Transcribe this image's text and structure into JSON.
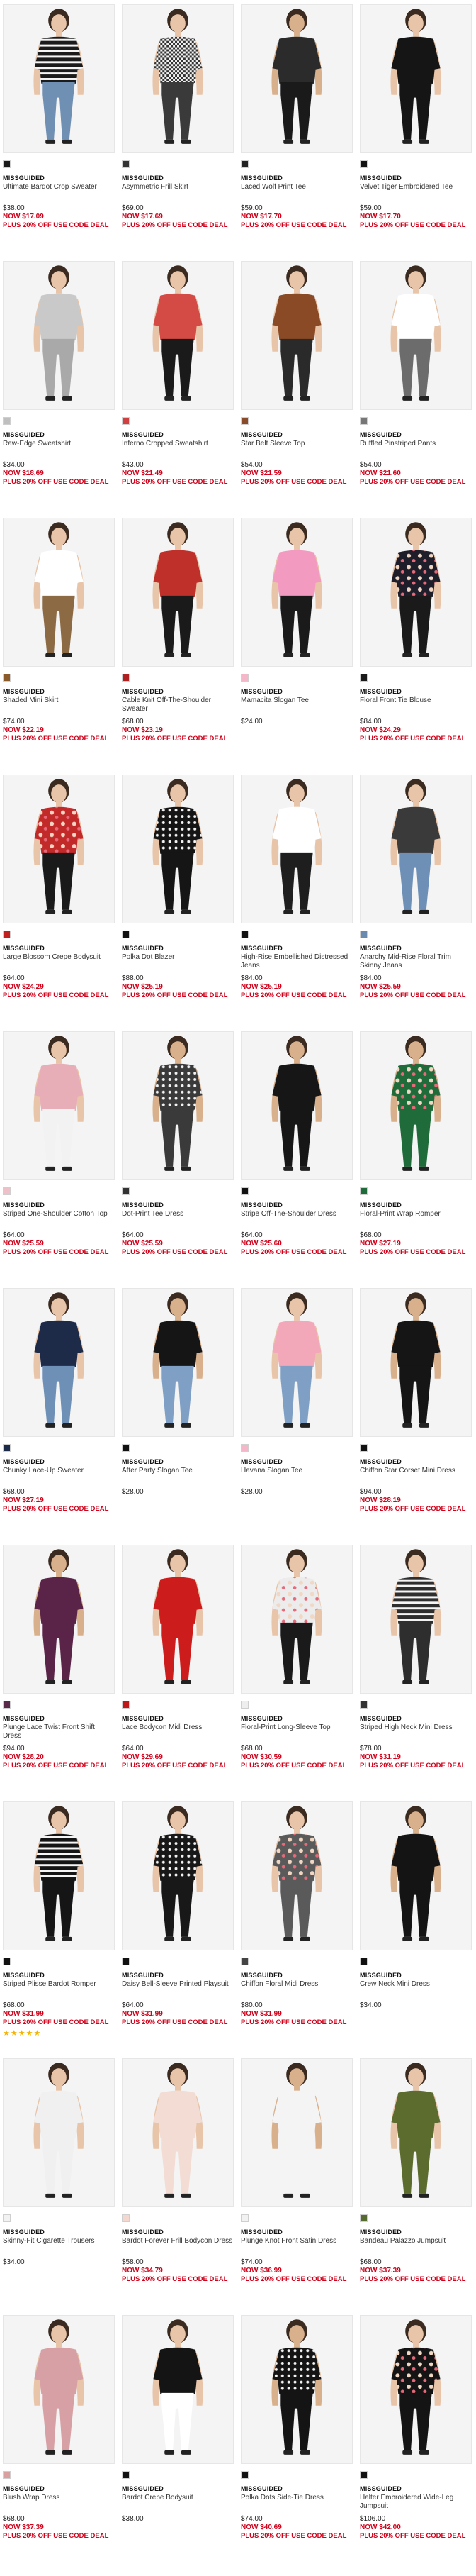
{
  "products": [
    {
      "brand": "MISSGUIDED",
      "name": "Ultimate Bardot Crop Sweater",
      "was": "$38.00",
      "now": "NOW $17.09",
      "promo": "PLUS 20% OFF USE CODE DEAL",
      "swatch": "#1a1a1a",
      "top": "#1b1b1b",
      "bottom": "#6f8fb3",
      "bg": "#f4f4f4",
      "skin": "#e8c4a8",
      "style": "stripe"
    },
    {
      "brand": "MISSGUIDED",
      "name": "Asymmetric Frill Skirt",
      "was": "$69.00",
      "now": "NOW $17.69",
      "promo": "PLUS 20% OFF USE CODE DEAL",
      "swatch": "#333333",
      "top": "#ffffff",
      "bottom": "#3a3a3a",
      "bg": "#f4f4f4",
      "skin": "#e8c4a8",
      "style": "check"
    },
    {
      "brand": "MISSGUIDED",
      "name": "Laced Wolf Print Tee",
      "was": "$59.00",
      "now": "NOW $17.70",
      "promo": "PLUS 20% OFF USE CODE DEAL",
      "swatch": "#222222",
      "top": "#2b2b2b",
      "bottom": "#1a1a1a",
      "bg": "#f4f4f4",
      "skin": "#d9b08c",
      "style": "plain"
    },
    {
      "brand": "MISSGUIDED",
      "name": "Velvet Tiger Embroidered Tee",
      "was": "$59.00",
      "now": "NOW $17.70",
      "promo": "PLUS 20% OFF USE CODE DEAL",
      "swatch": "#111111",
      "top": "#151515",
      "bottom": "#151515",
      "bg": "#f4f4f4",
      "skin": "#e8c4a8",
      "style": "plain"
    },
    {
      "brand": "MISSGUIDED",
      "name": "Raw-Edge Sweatshirt",
      "was": "$34.00",
      "now": "NOW $18.69",
      "promo": "PLUS 20% OFF USE CODE DEAL",
      "swatch": "#bfbfbf",
      "top": "#c9c9c9",
      "bottom": "#a9a9a9",
      "bg": "#f4f4f4",
      "skin": "#e8c4a8",
      "style": "plain"
    },
    {
      "brand": "MISSGUIDED",
      "name": "Inferno Cropped Sweatshirt",
      "was": "$43.00",
      "now": "NOW $21.49",
      "promo": "PLUS 20% OFF USE CODE DEAL",
      "swatch": "#d04040",
      "top": "#d44a45",
      "bottom": "#1a1a1a",
      "bg": "#f4f4f4",
      "skin": "#e8c4a8",
      "style": "plain"
    },
    {
      "brand": "MISSGUIDED",
      "name": "Star Belt Sleeve Top",
      "was": "$54.00",
      "now": "NOW $21.59",
      "promo": "PLUS 20% OFF USE CODE DEAL",
      "swatch": "#8a4b2a",
      "top": "#8a4a25",
      "bottom": "#2a2a2a",
      "bg": "#f4f4f4",
      "skin": "#e8c4a8",
      "style": "plain"
    },
    {
      "brand": "MISSGUIDED",
      "name": "Ruffled Pinstriped Pants",
      "was": "$54.00",
      "now": "NOW $21.60",
      "promo": "PLUS 20% OFF USE CODE DEAL",
      "swatch": "#777777",
      "top": "#ffffff",
      "bottom": "#6c6c6c",
      "bg": "#f4f4f4",
      "skin": "#e8c4a8",
      "style": "plain"
    },
    {
      "brand": "MISSGUIDED",
      "name": "Shaded Mini Skirt",
      "was": "$74.00",
      "now": "NOW $22.19",
      "promo": "PLUS 20% OFF USE CODE DEAL",
      "swatch": "#8a5a2b",
      "top": "#ffffff",
      "bottom": "#8b6a44",
      "bg": "#f4f4f4",
      "skin": "#e8c4a8",
      "style": "plain"
    },
    {
      "brand": "MISSGUIDED",
      "name": "Cable Knit Off-The-Shoulder Sweater",
      "was": "$68.00",
      "now": "NOW $23.19",
      "promo": "PLUS 20% OFF USE CODE DEAL",
      "swatch": "#b02020",
      "top": "#c0302b",
      "bottom": "#1a1a1a",
      "bg": "#f4f4f4",
      "skin": "#e8c4a8",
      "style": "plain"
    },
    {
      "brand": "MISSGUIDED",
      "name": "Mamacita Slogan Tee",
      "was": "$24.00",
      "now": "",
      "promo": "",
      "swatch": "#f4b6c8",
      "top": "#f29ac0",
      "bottom": "#1a1a1a",
      "bg": "#f4f4f4",
      "skin": "#e8c4a8",
      "style": "plain"
    },
    {
      "brand": "MISSGUIDED",
      "name": "Floral Front Tie Blouse",
      "was": "$84.00",
      "now": "NOW $24.29",
      "promo": "PLUS 20% OFF USE CODE DEAL",
      "swatch": "#1a1a1a",
      "top": "#1e1e2a",
      "bottom": "#1a1a1a",
      "bg": "#f4f4f4",
      "skin": "#e8c4a8",
      "style": "floral"
    },
    {
      "brand": "MISSGUIDED",
      "name": "Large Blossom Crepe Bodysuit",
      "was": "$64.00",
      "now": "NOW $24.29",
      "promo": "PLUS 20% OFF USE CODE DEAL",
      "swatch": "#c02020",
      "top": "#c22a2a",
      "bottom": "#1a1a1a",
      "bg": "#f4f4f4",
      "skin": "#e8c4a8",
      "style": "floral"
    },
    {
      "brand": "MISSGUIDED",
      "name": "Polka Dot Blazer",
      "was": "$88.00",
      "now": "NOW $25.19",
      "promo": "PLUS 20% OFF USE CODE DEAL",
      "swatch": "#111111",
      "top": "#151515",
      "bottom": "#151515",
      "bg": "#f4f4f4",
      "skin": "#e8c4a8",
      "style": "dots"
    },
    {
      "brand": "MISSGUIDED",
      "name": "High-Rise Embellished Distressed Jeans",
      "was": "$84.00",
      "now": "NOW $25.19",
      "promo": "PLUS 20% OFF USE CODE DEAL",
      "swatch": "#111111",
      "top": "#ffffff",
      "bottom": "#1e1e1e",
      "bg": "#f4f4f4",
      "skin": "#e8c4a8",
      "style": "plain"
    },
    {
      "brand": "MISSGUIDED",
      "name": "Anarchy Mid-Rise Floral Trim Skinny Jeans",
      "was": "$84.00",
      "now": "NOW $25.59",
      "promo": "PLUS 20% OFF USE CODE DEAL",
      "swatch": "#6a8ab0",
      "top": "#3a3a3a",
      "bottom": "#6e8fb6",
      "bg": "#f4f4f4",
      "skin": "#e8c4a8",
      "style": "plain"
    },
    {
      "brand": "MISSGUIDED",
      "name": "Striped One-Shoulder Cotton Top",
      "was": "$64.00",
      "now": "NOW $25.59",
      "promo": "PLUS 20% OFF USE CODE DEAL",
      "swatch": "#f0c0c8",
      "top": "#e8aeb8",
      "bottom": "#f2f2f2",
      "bg": "#f4f4f4",
      "skin": "#e8c4a8",
      "style": "plain"
    },
    {
      "brand": "MISSGUIDED",
      "name": "Dot-Print Tee Dress",
      "was": "$64.00",
      "now": "NOW $25.59",
      "promo": "PLUS 20% OFF USE CODE DEAL",
      "swatch": "#333333",
      "top": "#3a3a3a",
      "bottom": "#3a3a3a",
      "bg": "#f4f4f4",
      "skin": "#d9b08c",
      "style": "dots"
    },
    {
      "brand": "MISSGUIDED",
      "name": "Stripe Off-The-Shoulder Dress",
      "was": "$64.00",
      "now": "NOW $25.60",
      "promo": "PLUS 20% OFF USE CODE DEAL",
      "swatch": "#111111",
      "top": "#161616",
      "bottom": "#161616",
      "bg": "#f4f4f4",
      "skin": "#d9b08c",
      "style": "plain"
    },
    {
      "brand": "MISSGUIDED",
      "name": "Floral-Print Wrap Romper",
      "was": "$68.00",
      "now": "NOW $27.19",
      "promo": "PLUS 20% OFF USE CODE DEAL",
      "swatch": "#1f6b3a",
      "top": "#1f6b3a",
      "bottom": "#1f6b3a",
      "bg": "#f4f4f4",
      "skin": "#d9b08c",
      "style": "floral"
    },
    {
      "brand": "MISSGUIDED",
      "name": "Chunky Lace-Up Sweater",
      "was": "$68.00",
      "now": "NOW $27.19",
      "promo": "PLUS 20% OFF USE CODE DEAL",
      "swatch": "#1c2a4a",
      "top": "#1d2a48",
      "bottom": "#6e8fb6",
      "bg": "#f4f4f4",
      "skin": "#e8c4a8",
      "style": "plain"
    },
    {
      "brand": "MISSGUIDED",
      "name": "After Party Slogan Tee",
      "was": "$28.00",
      "now": "",
      "promo": "",
      "swatch": "#111111",
      "top": "#151515",
      "bottom": "#7fa0c4",
      "bg": "#f4f4f4",
      "skin": "#d9b08c",
      "style": "plain"
    },
    {
      "brand": "MISSGUIDED",
      "name": "Havana Slogan Tee",
      "was": "$28.00",
      "now": "",
      "promo": "",
      "swatch": "#f4b6c8",
      "top": "#f2a8b8",
      "bottom": "#7fa0c4",
      "bg": "#f4f4f4",
      "skin": "#e8c4a8",
      "style": "plain"
    },
    {
      "brand": "MISSGUIDED",
      "name": "Chiffon Star Corset Mini Dress",
      "was": "$94.00",
      "now": "NOW $28.19",
      "promo": "PLUS 20% OFF USE CODE DEAL",
      "swatch": "#111111",
      "top": "#151515",
      "bottom": "#151515",
      "bg": "#f4f4f4",
      "skin": "#d9b08c",
      "style": "plain"
    },
    {
      "brand": "MISSGUIDED",
      "name": "Plunge Lace Twist Front Shift Dress",
      "was": "$94.00",
      "now": "NOW $28.20",
      "promo": "PLUS 20% OFF USE CODE DEAL",
      "swatch": "#5a2a4a",
      "top": "#5a2448",
      "bottom": "#5a2448",
      "bg": "#f4f4f4",
      "skin": "#d9b08c",
      "style": "plain"
    },
    {
      "brand": "MISSGUIDED",
      "name": "Lace Bodycon Midi Dress",
      "was": "$64.00",
      "now": "NOW $29.69",
      "promo": "PLUS 20% OFF USE CODE DEAL",
      "swatch": "#c01818",
      "top": "#cc1c1c",
      "bottom": "#cc1c1c",
      "bg": "#f4f4f4",
      "skin": "#e8c4a8",
      "style": "plain"
    },
    {
      "brand": "MISSGUIDED",
      "name": "Floral-Print Long-Sleeve Top",
      "was": "$68.00",
      "now": "NOW $30.59",
      "promo": "PLUS 20% OFF USE CODE DEAL",
      "swatch": "#eeeeee",
      "top": "#ececec",
      "bottom": "#1a1a1a",
      "bg": "#f4f4f4",
      "skin": "#e8c4a8",
      "style": "floral"
    },
    {
      "brand": "MISSGUIDED",
      "name": "Striped High Neck Mini Dress",
      "was": "$78.00",
      "now": "NOW $31.19",
      "promo": "PLUS 20% OFF USE CODE DEAL",
      "swatch": "#333333",
      "top": "#2e2e2e",
      "bottom": "#2e2e2e",
      "bg": "#f4f4f4",
      "skin": "#e8c4a8",
      "style": "stripe"
    },
    {
      "brand": "MISSGUIDED",
      "name": "Striped Plisse Bardot Romper",
      "was": "$68.00",
      "now": "NOW $31.99",
      "promo": "PLUS 20% OFF USE CODE DEAL",
      "swatch": "#111111",
      "top": "#151515",
      "bottom": "#151515",
      "bg": "#f4f4f4",
      "skin": "#e8c4a8",
      "style": "stripe",
      "stars": "★★★★★"
    },
    {
      "brand": "MISSGUIDED",
      "name": "Daisy Bell-Sleeve Printed Playsuit",
      "was": "$64.00",
      "now": "NOW $31.99",
      "promo": "PLUS 20% OFF USE CODE DEAL",
      "swatch": "#111111",
      "top": "#181818",
      "bottom": "#181818",
      "bg": "#f4f4f4",
      "skin": "#e8c4a8",
      "style": "dots"
    },
    {
      "brand": "MISSGUIDED",
      "name": "Chiffon Floral Midi Dress",
      "was": "$80.00",
      "now": "NOW $31.99",
      "promo": "PLUS 20% OFF USE CODE DEAL",
      "swatch": "#444444",
      "top": "#5a5a5a",
      "bottom": "#5a5a5a",
      "bg": "#f4f4f4",
      "skin": "#e8c4a8",
      "style": "floral"
    },
    {
      "brand": "MISSGUIDED",
      "name": "Crew Neck Mini Dress",
      "was": "$34.00",
      "now": "",
      "promo": "",
      "swatch": "#111111",
      "top": "#141414",
      "bottom": "#141414",
      "bg": "#f4f4f4",
      "skin": "#d9b08c",
      "style": "plain"
    },
    {
      "brand": "MISSGUIDED",
      "name": "Skinny-Fit Cigarette Trousers",
      "was": "$34.00",
      "now": "",
      "promo": "",
      "swatch": "#f2f2f2",
      "top": "#f0f0f0",
      "bottom": "#f0f0f0",
      "bg": "#f4f4f4",
      "skin": "#e8c4a8",
      "style": "plain"
    },
    {
      "brand": "MISSGUIDED",
      "name": "Bardot Forever Frill Bodycon Dress",
      "was": "$58.00",
      "now": "NOW $34.79",
      "promo": "PLUS 20% OFF USE CODE DEAL",
      "swatch": "#f4d8d0",
      "top": "#f2dcd4",
      "bottom": "#f2dcd4",
      "bg": "#f4f4f4",
      "skin": "#e8c4a8",
      "style": "plain"
    },
    {
      "brand": "MISSGUIDED",
      "name": "Plunge Knot Front Satin Dress",
      "was": "$74.00",
      "now": "NOW $36.99",
      "promo": "PLUS 20% OFF USE CODE DEAL",
      "swatch": "#f2f2f2",
      "top": "#f4f4f4",
      "bottom": "#f4f4f4",
      "bg": "#f4f4f4",
      "skin": "#d9b08c",
      "style": "plain"
    },
    {
      "brand": "MISSGUIDED",
      "name": "Bandeau Palazzo Jumpsuit",
      "was": "$68.00",
      "now": "NOW $37.39",
      "promo": "PLUS 20% OFF USE CODE DEAL",
      "swatch": "#556b2f",
      "top": "#5c6b2e",
      "bottom": "#5c6b2e",
      "bg": "#f4f4f4",
      "skin": "#e8c4a8",
      "style": "plain"
    },
    {
      "brand": "MISSGUIDED",
      "name": "Blush Wrap Dress",
      "was": "$68.00",
      "now": "NOW $37.39",
      "promo": "PLUS 20% OFF USE CODE DEAL",
      "swatch": "#d9a0a0",
      "top": "#d7a0a4",
      "bottom": "#d7a0a4",
      "bg": "#f4f4f4",
      "skin": "#e8c4a8",
      "style": "plain"
    },
    {
      "brand": "MISSGUIDED",
      "name": "Bardot Crepe Bodysuit",
      "was": "$38.00",
      "now": "",
      "promo": "",
      "swatch": "#111111",
      "top": "#141414",
      "bottom": "#ffffff",
      "bg": "#f4f4f4",
      "skin": "#e8c4a8",
      "style": "plain"
    },
    {
      "brand": "MISSGUIDED",
      "name": "Polka Dots Side-Tie Dress",
      "was": "$74.00",
      "now": "NOW $40.69",
      "promo": "PLUS 20% OFF USE CODE DEAL",
      "swatch": "#111111",
      "top": "#141414",
      "bottom": "#141414",
      "bg": "#f4f4f4",
      "skin": "#d9b08c",
      "style": "dots"
    },
    {
      "brand": "MISSGUIDED",
      "name": "Halter Embroidered Wide-Leg Jumpsuit",
      "was": "$106.00",
      "now": "NOW $42.00",
      "promo": "PLUS 20% OFF USE CODE DEAL",
      "swatch": "#111111",
      "top": "#141414",
      "bottom": "#141414",
      "bg": "#f4f4f4",
      "skin": "#e8c4a8",
      "style": "floral"
    }
  ]
}
